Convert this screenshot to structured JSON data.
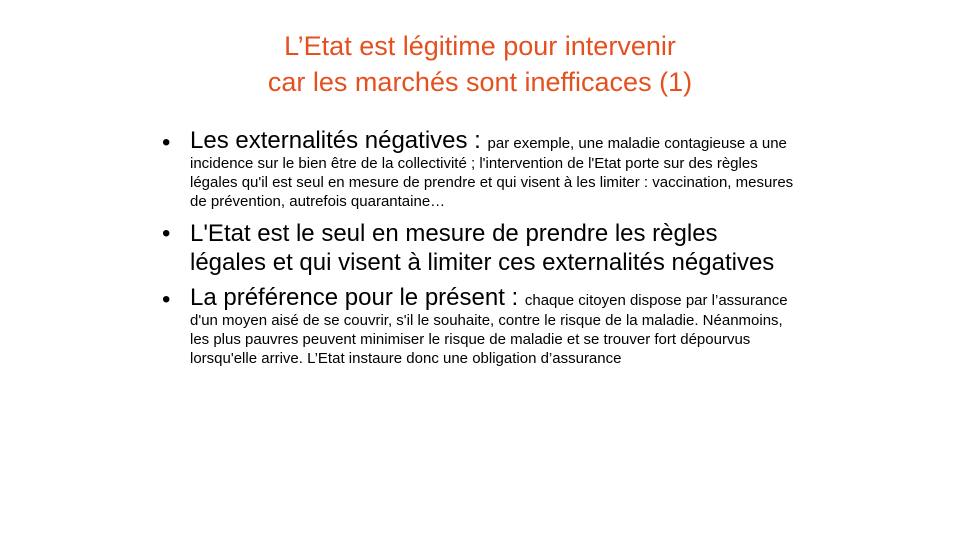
{
  "slide": {
    "title_line1": "L’Etat est légitime pour intervenir",
    "title_line2": "car les marchés sont inefficaces (1)",
    "title_color": "#E5501F",
    "bullet_glyph": "•",
    "bullets": [
      {
        "lead": "Les externalités négatives : ",
        "detail": "par exemple, une maladie contagieuse a une incidence sur le bien être de la collectivité ; l'intervention de l'Etat porte sur des règles légales qu'il est seul en mesure de prendre et qui visent à les limiter : vaccination, mesures de prévention, autrefois quarantaine…"
      },
      {
        "lead": "L'Etat est le seul en mesure de prendre les règles légales et qui visent à limiter ces externalités négatives",
        "detail": ""
      },
      {
        "lead": "La préférence pour le présent : ",
        "detail": "chaque citoyen dispose par l’assurance d'un moyen aisé de se couvrir, s'il le souhaite, contre le risque de la maladie. Néanmoins, les plus pauvres peuvent minimiser le risque de maladie et se trouver fort dépourvus lorsqu'elle arrive. L’Etat instaure donc une obligation d’assurance"
      }
    ]
  }
}
